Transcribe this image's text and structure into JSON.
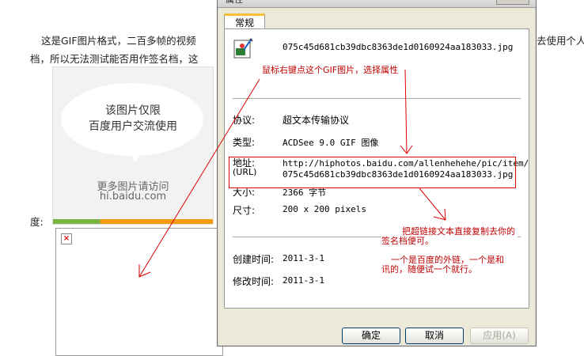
{
  "background": {
    "line1": "这是GIF图片格式，二百多帧的视频",
    "line1_right": "去使用个人",
    "line2": "档，所以无法测试能否用作签名档，这",
    "du_label": "度:",
    "placeholder": {
      "line1": "该图片仅限",
      "line2": "百度用户交流使用",
      "more": "更多图片请访问",
      "site": "hi.baidu.com"
    }
  },
  "dialog": {
    "title": "属性",
    "tab_label": "常规",
    "file_name": "075c45d681cb39dbc8363de1d0160924aa183033.jpg",
    "protocol_label": "协议:",
    "protocol_value": "超文本传输协议",
    "type_label": "类型:",
    "type_value": "ACDSee 9.0 GIF 图像",
    "address_label": "地址:",
    "address_label2": "(URL)",
    "address_line1": "http://hiphotos.baidu.com/allenhehehe/pic/item/",
    "address_line2": "075c45d681cb39dbc8363de1d0160924aa183033.jpg",
    "size_label": "大小:",
    "size_value": "2366 字节",
    "dims_label": "尺寸:",
    "dims_value": "200  x  200  pixels",
    "created_label": "创建时间:",
    "created_value": "2011-3-1",
    "modified_label": "修改时间:",
    "modified_value": "2011-3-1",
    "ok_label": "确定",
    "cancel_label": "取消",
    "apply_label": "应用(A)"
  },
  "annotations": {
    "right_click_note": "鼠标右键点这个GIF图片，选择属性",
    "copy_note_line1": "把超链接文本直接复制去你的",
    "copy_note_line2": "签名档便可。",
    "link_note_line1": "一个是百度的外链，一个是和",
    "link_note_line2": "讯的，随便试一个就行。"
  },
  "colors": {
    "annotation_red": "#cc0000",
    "dialog_bg": "#ece9d8",
    "tab_accent": "#f7c03b"
  }
}
